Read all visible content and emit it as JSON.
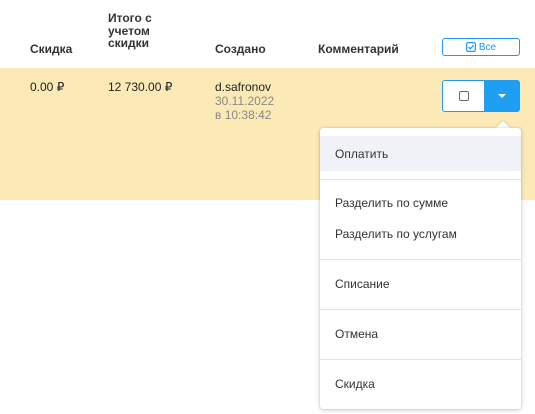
{
  "table": {
    "headers": {
      "discount": "Скидка",
      "total_with_discount": [
        "Итого с",
        "учетом",
        "скидки"
      ],
      "created": "Создано",
      "comment": "Комментарий"
    },
    "all_button_label": "Все",
    "row": {
      "discount": "0.00 ₽",
      "total_with_discount": "12 730.00 ₽",
      "created_by": "d.safronov",
      "created_date": "30.11.2022",
      "created_time": "в 10:38:42",
      "comment": ""
    }
  },
  "dropdown": {
    "items": [
      "Оплатить",
      "Разделить по сумме",
      "Разделить по услугам",
      "Списание",
      "Отмена",
      "Скидка"
    ]
  },
  "colors": {
    "accent": "#1e9ff2",
    "row_highlight": "#fbe9b6",
    "menu_hover": "#f0f2f7"
  }
}
